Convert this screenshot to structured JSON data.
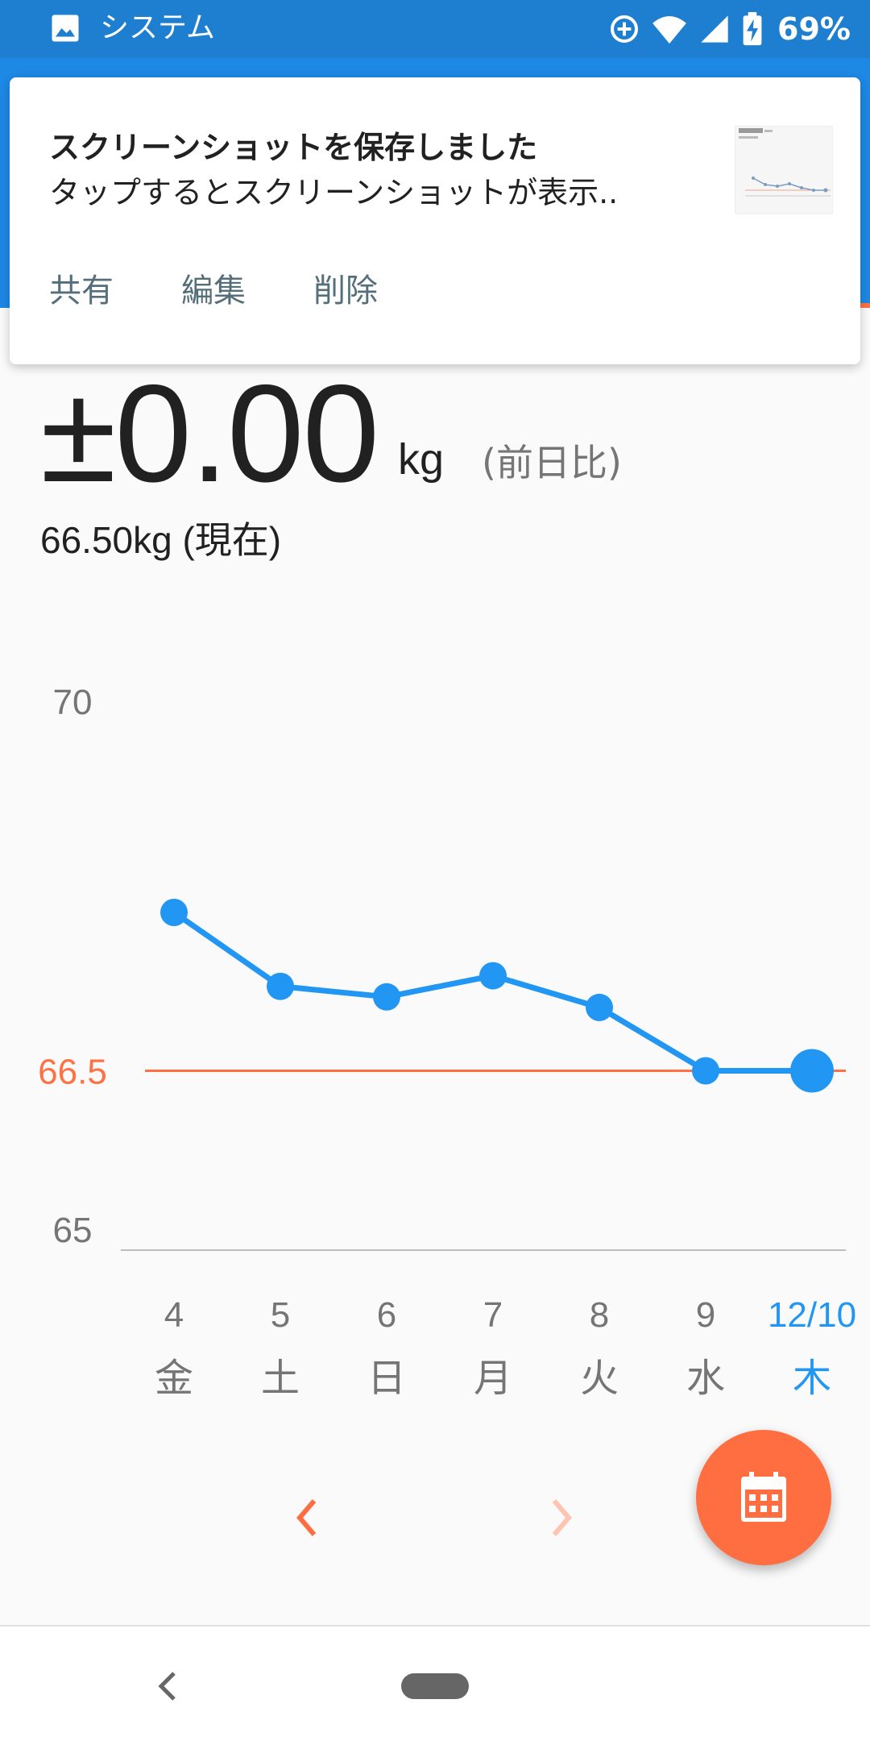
{
  "status_bar": {
    "app_name": "システム",
    "battery_percent": "69%",
    "icons": [
      "gallery-icon",
      "data-saver-icon",
      "wifi-icon",
      "cell-signal-icon",
      "battery-charging-icon"
    ]
  },
  "notification": {
    "title": "スクリーンショットを保存しました",
    "body": "タップするとスクリーンショットが表示..",
    "actions": {
      "share": "共有",
      "edit": "編集",
      "delete": "削除"
    }
  },
  "summary": {
    "diff_value": "±0.00",
    "diff_unit": "kg",
    "compare_label": "(前日比)",
    "current_weight": "66.50kg (現在)"
  },
  "chart_data": {
    "type": "line",
    "x": [
      "4",
      "5",
      "6",
      "7",
      "8",
      "9",
      "12/10"
    ],
    "weekdays": [
      "金",
      "土",
      "日",
      "月",
      "火",
      "水",
      "木"
    ],
    "values": [
      68.0,
      67.3,
      67.2,
      67.4,
      67.1,
      66.5,
      66.5
    ],
    "y_ticks": [
      "70",
      "65"
    ],
    "ylim": [
      65,
      70
    ],
    "reference_line": {
      "value": 66.5,
      "label": "66.5",
      "color": "#ff7043"
    },
    "selected_index": 6,
    "line_color": "#2196f3",
    "selected_color": "#2196f3",
    "grid": false
  },
  "colors": {
    "status_bar": "#1e7fd1",
    "accent": "#ff6e40",
    "primary": "#1e88e5"
  },
  "fab": {
    "icon": "calendar-icon"
  },
  "nav": {
    "prev_icon": "chevron-left-icon",
    "next_icon": "chevron-right-icon"
  }
}
